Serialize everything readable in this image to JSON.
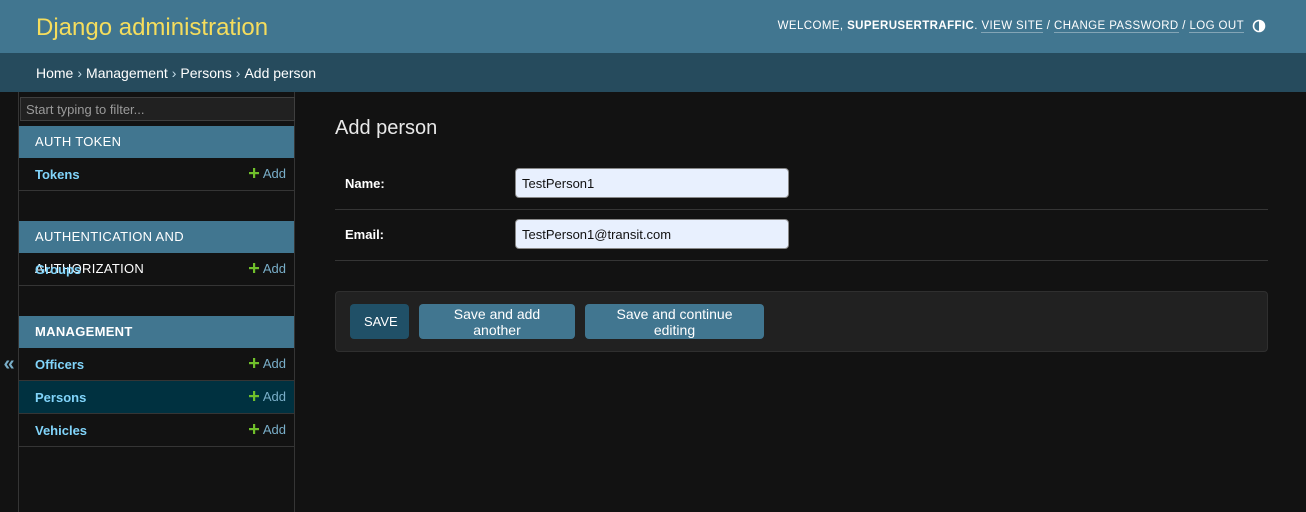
{
  "header": {
    "site_name": "Django administration",
    "welcome": "WELCOME, ",
    "username": "SUPERUSERTRAFFIC",
    "period": ".",
    "view_site": "VIEW SITE",
    "change_password": "CHANGE PASSWORD",
    "log_out": "LOG OUT",
    "slash": " / ",
    "theme_icon": "contrast-half-circle-icon"
  },
  "breadcrumbs": {
    "items": [
      "Home",
      "Management",
      "Persons"
    ],
    "separator": "›",
    "current": "Add person"
  },
  "sidebar": {
    "filter_placeholder": "Start typing to filter...",
    "collapse_label": "«",
    "add_label": "Add",
    "modules": [
      {
        "caption": "Auth Token",
        "models": [
          "Tokens"
        ]
      },
      {
        "caption": "Authentication and Authorization",
        "models": [
          "Groups"
        ]
      },
      {
        "caption": "Management",
        "models": [
          "Officers",
          "Persons",
          "Vehicles"
        ]
      }
    ],
    "current_module": "Management",
    "current_model": "Persons"
  },
  "content": {
    "title": "Add person",
    "fields": [
      {
        "label": "Name:",
        "value": "TestPerson1"
      },
      {
        "label": "Email:",
        "value": "TestPerson1@transit.com"
      }
    ],
    "buttons": {
      "save": "SAVE",
      "save_add_another": "Save and add another",
      "save_continue": "Save and continue editing"
    }
  },
  "colors": {
    "header_bg": "#417690",
    "breadcrumb_bg": "#264b5d",
    "site_name": "#f5dd5d",
    "link": "#81d4fa",
    "add_plus": "#70bf2b",
    "page_bg": "#121212"
  }
}
